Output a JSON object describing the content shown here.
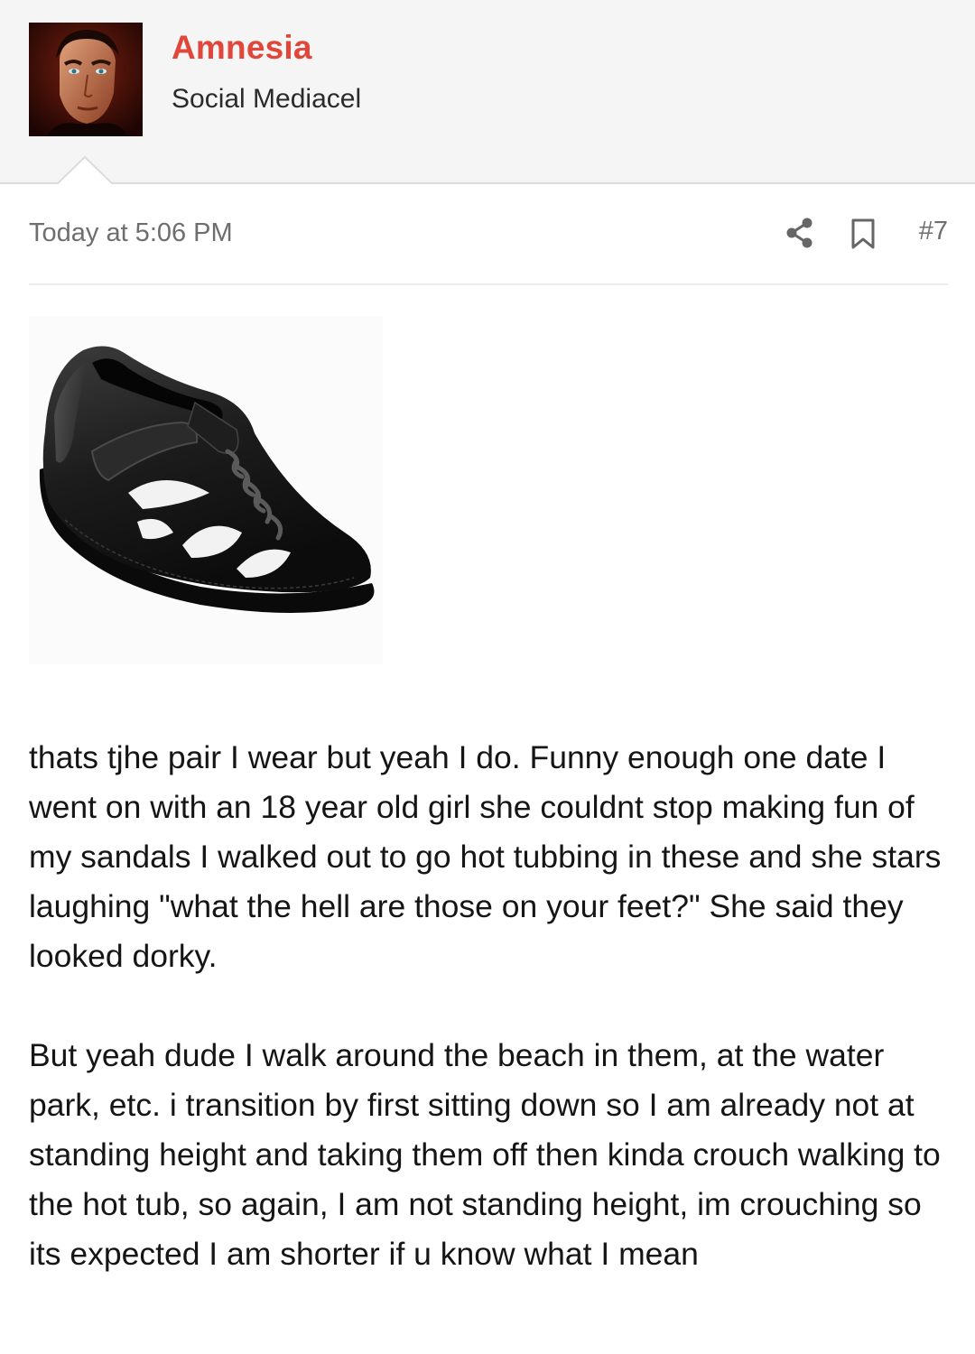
{
  "author": {
    "name": "Amnesia",
    "title": "Social Mediacel",
    "avatar_icon": "user-avatar-photo"
  },
  "post": {
    "date": "Today at 5:06 PM",
    "number": "#7",
    "share_icon": "share-icon",
    "bookmark_icon": "bookmark-icon",
    "image_subject": "black-leather-sandal",
    "paragraphs": [
      "thats tjhe pair I wear but yeah I do. Funny enough one date I went on with an 18 year old girl she couldnt stop making fun of my sandals I walked out to go hot tubbing in these and she stars laughing \"what the hell are those on your feet?\" She said they looked dorky.",
      "But yeah dude I walk around the beach in them, at the water park, etc. i transition by first sitting down so I am already not at standing height and taking them off then kinda crouch walking to the hot tub, so again, I am not standing height, im crouching so its expected I am shorter if u know what I mean"
    ]
  },
  "colors": {
    "accent": "#e0473a",
    "header_bg": "#f5f5f5",
    "meta_text": "#6e6e6e"
  }
}
